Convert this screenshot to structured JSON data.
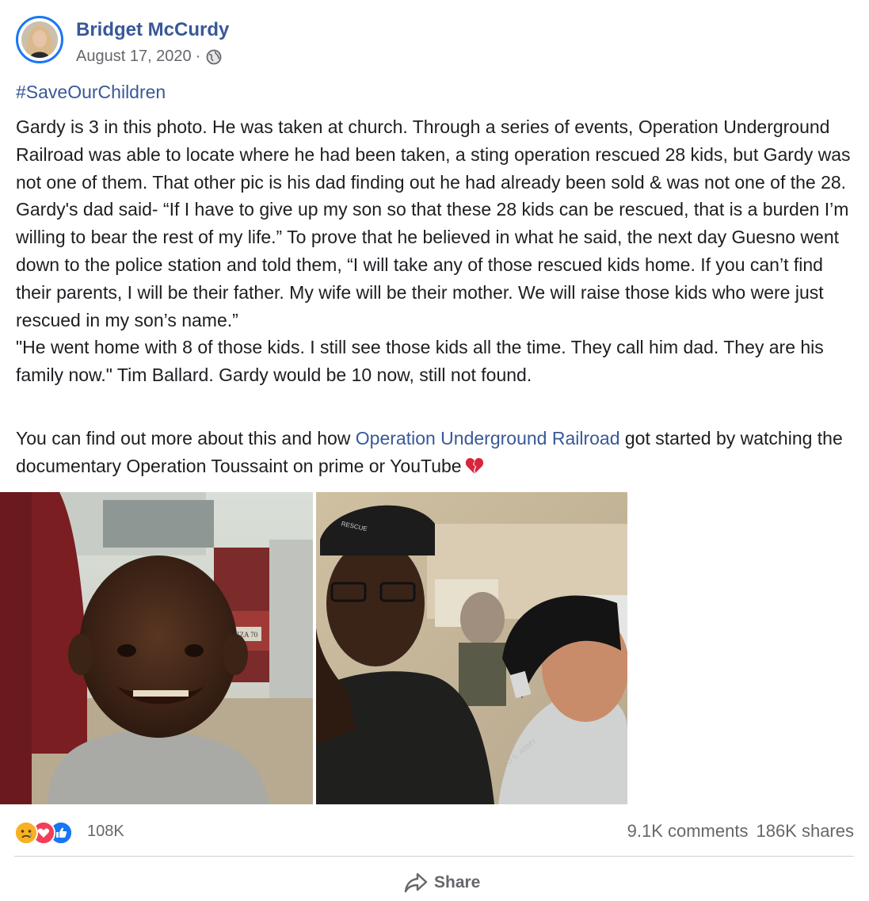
{
  "post": {
    "author": "Bridget McCurdy",
    "date": "August 17, 2020",
    "separator": "·",
    "privacy_icon": "globe-icon",
    "hashtag": "#SaveOurChildren",
    "paragraph1": "Gardy is 3 in this photo. He was taken at church. Through a series of events, Operation Underground Railroad was able to locate where he had been taken, a sting operation rescued 28 kids, but Gardy was not one of them. That other pic is his dad finding out he had already been sold & was not one of the 28. Gardy's dad said- “If I have to give up my son so that these 28 kids can be rescued, that is a burden I’m willing to bear the rest of my life.” To prove that he believed in what he said, the next day Guesno went down to the police station and told them, “I will take any of those rescued kids home. If you can’t find their parents, I will be their father. My wife will be their mother. We will raise those kids who were just rescued in my son’s name.”",
    "paragraph1b": "\"He went home with 8 of those kids. I still see those kids all the time. They call him dad. They are his family now.\" Tim Ballard. Gardy would be 10 now, still not found.",
    "paragraph2_start": "You can find out more about this and how ",
    "paragraph2_link": "Operation Underground Railroad",
    "paragraph2_end": " got started by watching the documentary Operation Toussaint on prime or YouTube",
    "emoji": "broken-heart-icon",
    "photo_texts": {
      "cap_brand": "RESCUE",
      "plate": "ZZA 70",
      "hat_text": "U.S. ARMY"
    }
  },
  "footer": {
    "reactions": [
      "sad-icon",
      "love-icon",
      "like-icon"
    ],
    "reaction_count": "108K",
    "comments": "9.1K comments",
    "shares": "186K shares",
    "share_label": "Share"
  },
  "colors": {
    "link": "#385898",
    "secondary": "#65676b",
    "accent": "#1877f2"
  }
}
